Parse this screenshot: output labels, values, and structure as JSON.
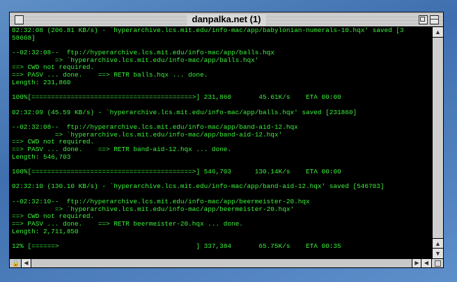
{
  "window": {
    "title": "danpalka.net (1)"
  },
  "terminal": {
    "lines": [
      "02:32:08 (206.81 KB/s) - `hyperarchive.lcs.mit.edu/info-mac/app/babylonian-numerals-10.hqx' saved [3",
      "58668]",
      "",
      "--02:32:08--  ftp://hyperarchive.lcs.mit.edu/info-mac/app/balls.hqx",
      "           => `hyperarchive.lcs.mit.edu/info-mac/app/balls.hqx'",
      "==> CWD not required.",
      "==> PASV ... done.    ==> RETR balls.hqx ... done.",
      "Length: 231,860",
      "",
      "100%[=========================================>] 231,860       45.61K/s    ETA 00:00",
      "",
      "02:32:09 (45.59 KB/s) - `hyperarchive.lcs.mit.edu/info-mac/app/balls.hqx' saved [231860]",
      "",
      "--02:32:08--  ftp://hyperarchive.lcs.mit.edu/info-mac/app/band-aid-12.hqx",
      "           => `hyperarchive.lcs.mit.edu/info-mac/app/band-aid-12.hqx'",
      "==> CWD not required.",
      "==> PASV ... done.    ==> RETR band-aid-12.hqx ... done.",
      "Length: 546,703",
      "",
      "100%[=========================================>] 546,703      130.14K/s    ETA 00:00",
      "",
      "02:32:10 (130.10 KB/s) - `hyperarchive.lcs.mit.edu/info-mac/app/band-aid-12.hqx' saved [546703]",
      "",
      "--02:32:10--  ftp://hyperarchive.lcs.mit.edu/info-mac/app/beermeister-20.hqx",
      "           => `hyperarchive.lcs.mit.edu/info-mac/app/beermeister-20.hqx'",
      "==> CWD not required.",
      "==> PASV ... done.    ==> RETR beermeister-20.hqx ... done.",
      "Length: 2,711,850",
      "",
      "12% [======>                                   ] 337,384       65.75K/s    ETA 00:35"
    ]
  },
  "colors": {
    "terminal_text": "#3cf03c",
    "terminal_bg": "#000000"
  },
  "icons": {
    "scroll_up": "▲",
    "scroll_down": "▼",
    "scroll_left": "◀",
    "scroll_right": "▶",
    "lock": "🔒"
  }
}
